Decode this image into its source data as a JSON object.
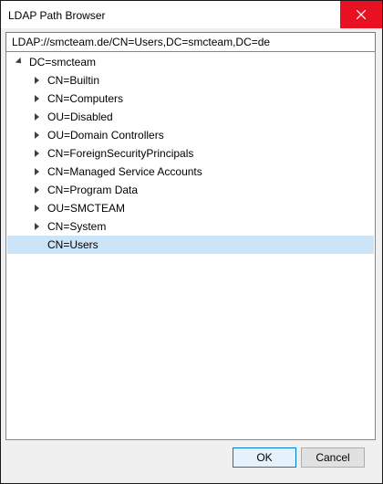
{
  "window": {
    "title": "LDAP Path Browser",
    "close_icon": "close-icon",
    "accent_close": "#e81123"
  },
  "path": {
    "value": "LDAP://smcteam.de/CN=Users,DC=smcteam,DC=de"
  },
  "tree": {
    "root": {
      "label": "DC=smcteam",
      "expanded": true
    },
    "children": [
      {
        "label": "CN=Builtin",
        "expandable": true,
        "selected": false
      },
      {
        "label": "CN=Computers",
        "expandable": true,
        "selected": false
      },
      {
        "label": "OU=Disabled",
        "expandable": true,
        "selected": false
      },
      {
        "label": "OU=Domain Controllers",
        "expandable": true,
        "selected": false
      },
      {
        "label": "CN=ForeignSecurityPrincipals",
        "expandable": true,
        "selected": false
      },
      {
        "label": "CN=Managed Service Accounts",
        "expandable": true,
        "selected": false
      },
      {
        "label": "CN=Program Data",
        "expandable": true,
        "selected": false
      },
      {
        "label": "OU=SMCTEAM",
        "expandable": true,
        "selected": false
      },
      {
        "label": "CN=System",
        "expandable": true,
        "selected": false
      },
      {
        "label": "CN=Users",
        "expandable": false,
        "selected": true
      }
    ],
    "selection_color": "#cce4f7"
  },
  "buttons": {
    "ok_label": "OK",
    "cancel_label": "Cancel"
  }
}
